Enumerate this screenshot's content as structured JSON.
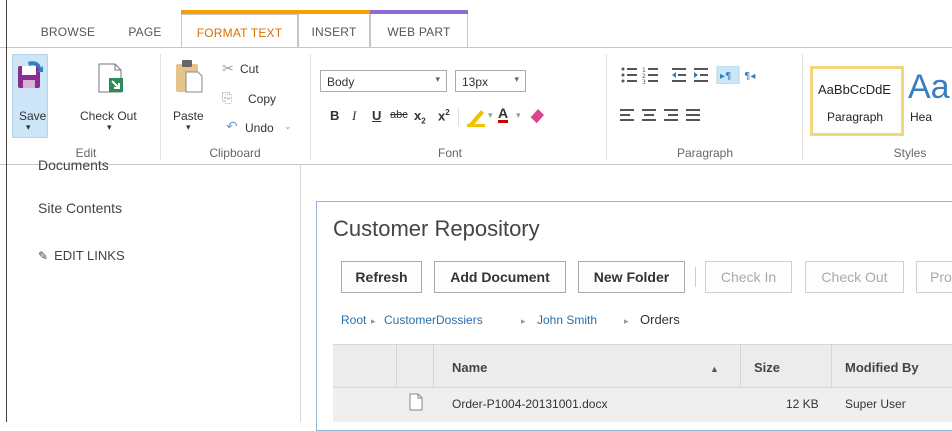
{
  "tabs": [
    {
      "label": "BROWSE"
    },
    {
      "label": "PAGE"
    },
    {
      "label": "FORMAT TEXT"
    },
    {
      "label": "INSERT"
    },
    {
      "label": "WEB PART"
    }
  ],
  "colors": {
    "format_text_accent": "#f8a000",
    "web_part_accent": "#8e6cd6",
    "selected_tab_text": "#d96f00",
    "link": "#2a6ea8"
  },
  "ribbon": {
    "edit": {
      "save_label": "Save",
      "checkout_label": "Check Out",
      "group_label": "Edit"
    },
    "clipboard": {
      "paste_label": "Paste",
      "cut_label": "Cut",
      "copy_label": "Copy",
      "undo_label": "Undo",
      "group_label": "Clipboard"
    },
    "font": {
      "font_name": "Body",
      "font_size": "13px",
      "group_label": "Font"
    },
    "paragraph": {
      "group_label": "Paragraph"
    },
    "styles": {
      "preview1_sample": "AaBbCcDdE",
      "preview1_name": "Paragraph",
      "preview2_sample": "Aa",
      "preview2_name": "Hea",
      "group_label": "Styles"
    }
  },
  "leftnav": {
    "documents": "Documents",
    "site_contents": "Site Contents",
    "edit_links": "EDIT LINKS"
  },
  "webpart": {
    "title": "Customer Repository",
    "buttons": [
      {
        "label": "Refresh"
      },
      {
        "label": "Add Document"
      },
      {
        "label": "New Folder"
      },
      {
        "label": "Check In"
      },
      {
        "label": "Check Out"
      },
      {
        "label": "Pro"
      }
    ],
    "breadcrumb": [
      "Root",
      "CustomerDossiers",
      "John Smith",
      "Orders"
    ],
    "columns": {
      "name": "Name",
      "size": "Size",
      "modified_by": "Modified By"
    },
    "rows": [
      {
        "name": "Order-P1004-20131001.docx",
        "size": "12 KB",
        "modified_by": "Super User"
      }
    ]
  }
}
